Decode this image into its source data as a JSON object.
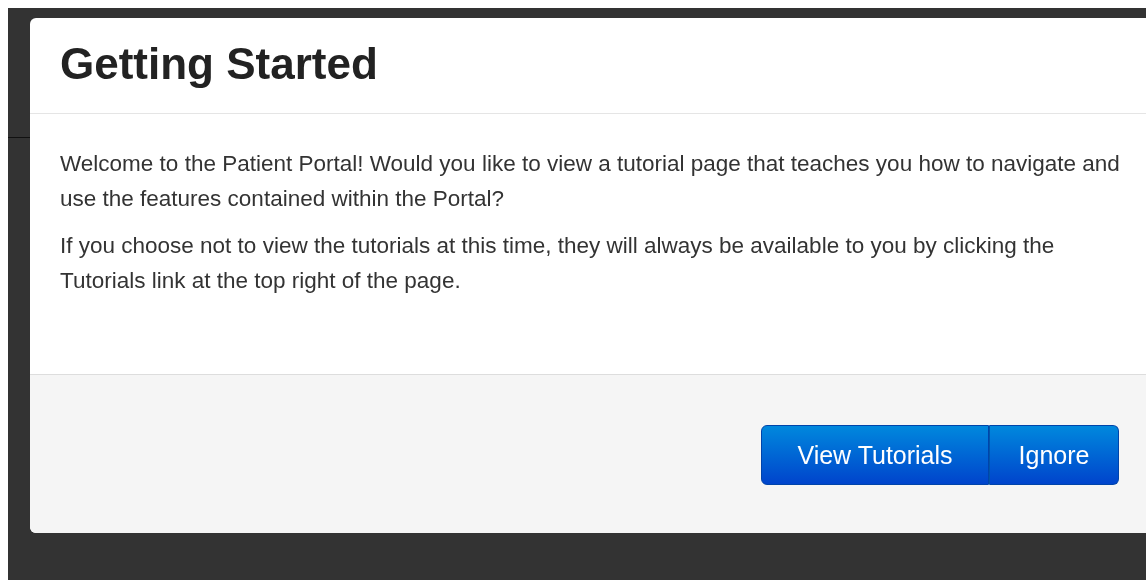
{
  "dialog": {
    "title": "Getting Started",
    "paragraphs": [
      "Welcome to the Patient Portal! Would you like to view a tutorial page that teaches you how to navigate and use the features contained within the Portal?",
      "If you choose not to view the tutorials at this time, they will always be available to you by clicking the Tutorials link at the top right of the page."
    ],
    "buttons": [
      "View Tutorials",
      "Ignore"
    ]
  }
}
